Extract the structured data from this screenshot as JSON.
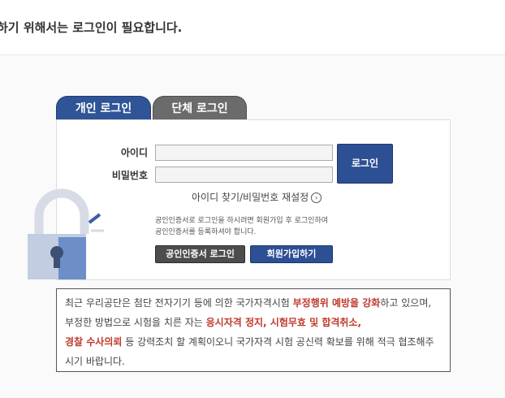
{
  "header": {
    "message": "하기 위해서는 로그인이 필요합니다."
  },
  "tabs": [
    {
      "label": "개인 로그인",
      "active": true
    },
    {
      "label": "단체 로그인",
      "active": false
    }
  ],
  "form": {
    "id_label": "아이디",
    "pw_label": "비밀번호",
    "id_value": "",
    "pw_value": "",
    "login_button": "로그인",
    "find_link": "아이디 찾기/비밀번호 재설정",
    "notice_line1": "공인인증서로 로그인을 하시려면 회원가입 후 로그인하여",
    "notice_line2": "공인인증서를 등록하셔야 합니다.",
    "cert_button": "공인인증서 로그인",
    "join_button": "회원가입하기"
  },
  "warning": {
    "p1": "최근 우리공단은 첨단 전자기기 등에 의한 국가자격시험 ",
    "h1": "부정행위 예방을 강화",
    "p2": "하고 있으며, 부정한 방법으로 시험을 치른 자는 ",
    "h2": "응시자격 정지, 시험무효 및 합격취소,",
    "h3": "경찰 수사의뢰",
    "p3": " 등 강력조치 할 계획이오니 국가자격 시험 공신력 확보를 위해 적극 협조해주시기 바랍니다."
  },
  "colors": {
    "primary": "#2f5497",
    "inactive_tab": "#6b6b6b",
    "highlight": "#c0392b"
  },
  "icons": {
    "lock": "lock-icon",
    "arrow": "chevron-right-circle-icon"
  }
}
